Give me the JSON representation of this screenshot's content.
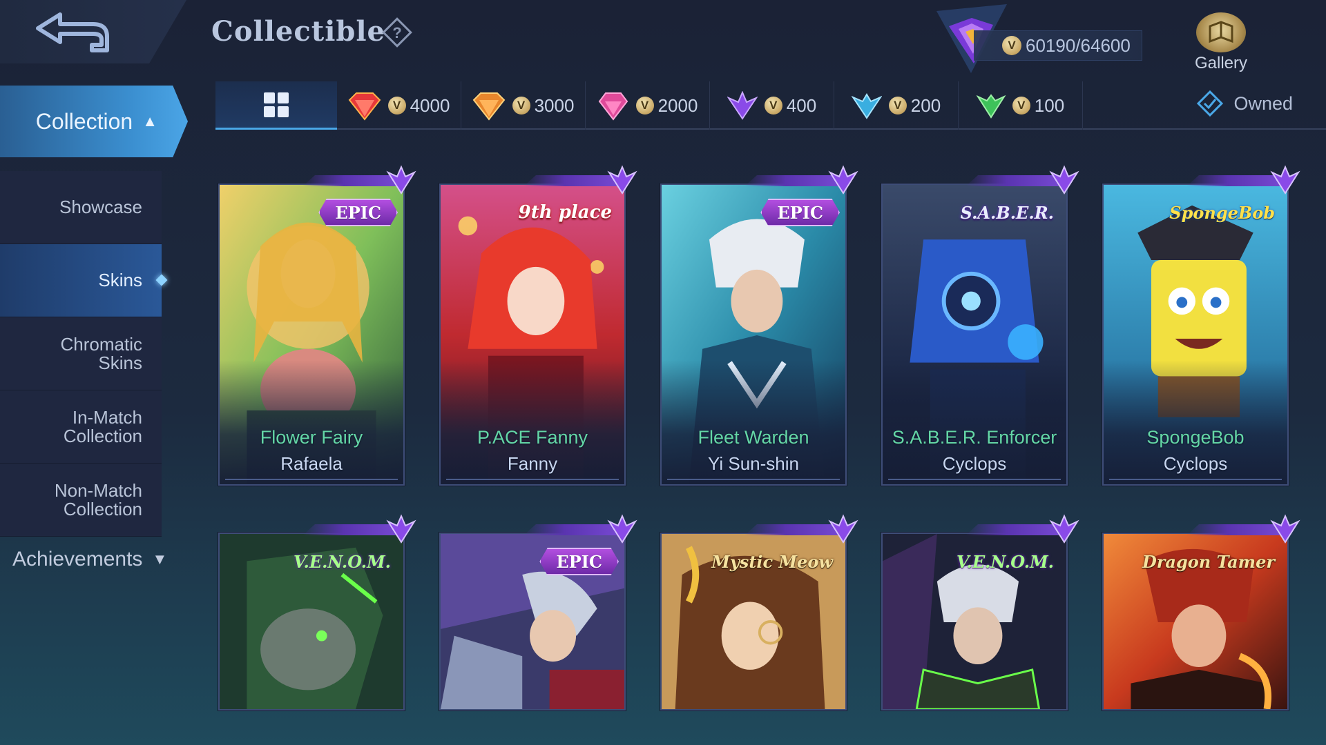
{
  "header": {
    "title": "Collectible",
    "points": "60190/64600",
    "gallery_label": "Gallery"
  },
  "sidebar": {
    "collection_label": "Collection",
    "items": [
      {
        "label": "Showcase"
      },
      {
        "label": "Skins"
      },
      {
        "label": "Chromatic\nSkins"
      },
      {
        "label": "In-Match\nCollection"
      },
      {
        "label": "Non-Match\nCollection"
      }
    ],
    "achievements_label": "Achievements"
  },
  "filters": {
    "tiers": [
      {
        "value": "4000",
        "color": "#e8383a"
      },
      {
        "value": "3000",
        "color": "#e8862c"
      },
      {
        "value": "2000",
        "color": "#e04a9a"
      },
      {
        "value": "400",
        "color": "#8a4ae8"
      },
      {
        "value": "200",
        "color": "#3aaee0"
      },
      {
        "value": "100",
        "color": "#3ec25a"
      }
    ],
    "owned_label": "Owned"
  },
  "cards": [
    {
      "skin": "Flower Fairy",
      "hero": "Rafaela",
      "badge": "EPIC"
    },
    {
      "skin": "P.ACE Fanny",
      "hero": "Fanny",
      "badge": "9th place"
    },
    {
      "skin": "Fleet Warden",
      "hero": "Yi Sun-shin",
      "badge": "EPIC"
    },
    {
      "skin": "S.A.B.E.R. Enforcer",
      "hero": "Cyclops",
      "badge": "S.A.B.E.R."
    },
    {
      "skin": "SpongeBob",
      "hero": "Cyclops",
      "badge": "SpongeBob"
    },
    {
      "badge": "V.E.N.O.M."
    },
    {
      "badge": "EPIC"
    },
    {
      "badge": "Mystic Meow"
    },
    {
      "badge": "V.E.N.O.M."
    },
    {
      "badge": "Dragon Tamer"
    }
  ],
  "colors": {
    "accent": "#4aa8e8",
    "skin_name": "#64d6a6",
    "epic": "#9a3fd0"
  }
}
